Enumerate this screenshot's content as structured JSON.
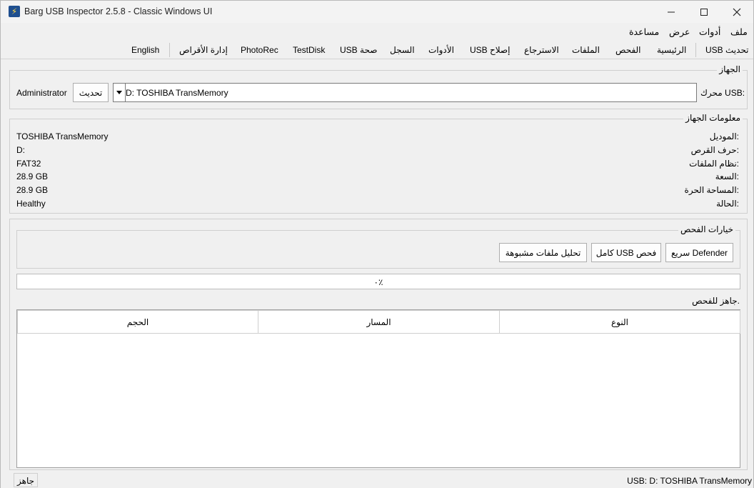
{
  "window": {
    "title": "Barg USB Inspector 2.5.8 - Classic Windows UI"
  },
  "menu": {
    "file": "ملف",
    "tools": "أدوات",
    "view": "عرض",
    "help": "مساعدة"
  },
  "toolbar": {
    "refresh_usb": "USB تحديث",
    "home": "الرئيسية",
    "scan": "الفحص",
    "files": "الملفات",
    "recovery": "الاسترجاع",
    "usb_repair": "USB إصلاح",
    "tools": "الأدوات",
    "log": "السجل",
    "usb_health": "USB صحة",
    "testdisk": "TestDisk",
    "photorec": "PhotoRec",
    "disk_mgmt": "إدارة الأقراص",
    "language": "English"
  },
  "device": {
    "group_title": "الجهاز",
    "drive_label": "محرك USB:",
    "drive_value": "D:  TOSHIBA TransMemory",
    "refresh_btn": "تحديث",
    "user": "Administrator"
  },
  "info": {
    "group_title": "معلومات الجهاز",
    "rows": [
      {
        "label": "الموديل:",
        "value": "TOSHIBA TransMemory"
      },
      {
        "label": "حرف القرص:",
        "value": "D:"
      },
      {
        "label": "نظام الملفات:",
        "value": "FAT32"
      },
      {
        "label": "السعة:",
        "value": "28.9 GB"
      },
      {
        "label": "المساحة الحرة:",
        "value": "28.9 GB"
      },
      {
        "label": "الحالة:",
        "value": "Healthy"
      }
    ]
  },
  "scan_options": {
    "group_title": "خيارات الفحص",
    "quick_btn": "سريع Defender",
    "full_btn": "كامل USB فحص",
    "suspicious_btn": "تحليل ملفات مشبوهة"
  },
  "progress": {
    "value": 0,
    "text": "٠٪"
  },
  "status_text": "جاهز للفحص.",
  "table": {
    "columns": [
      "النوع",
      "المسار",
      "الحجم"
    ],
    "rows": []
  },
  "statusbar": {
    "left": "جاهز",
    "right": "USB: D: TOSHIBA TransMemory"
  },
  "colors": {
    "progress": "#06b025",
    "window_bg": "#f0f0f0"
  }
}
